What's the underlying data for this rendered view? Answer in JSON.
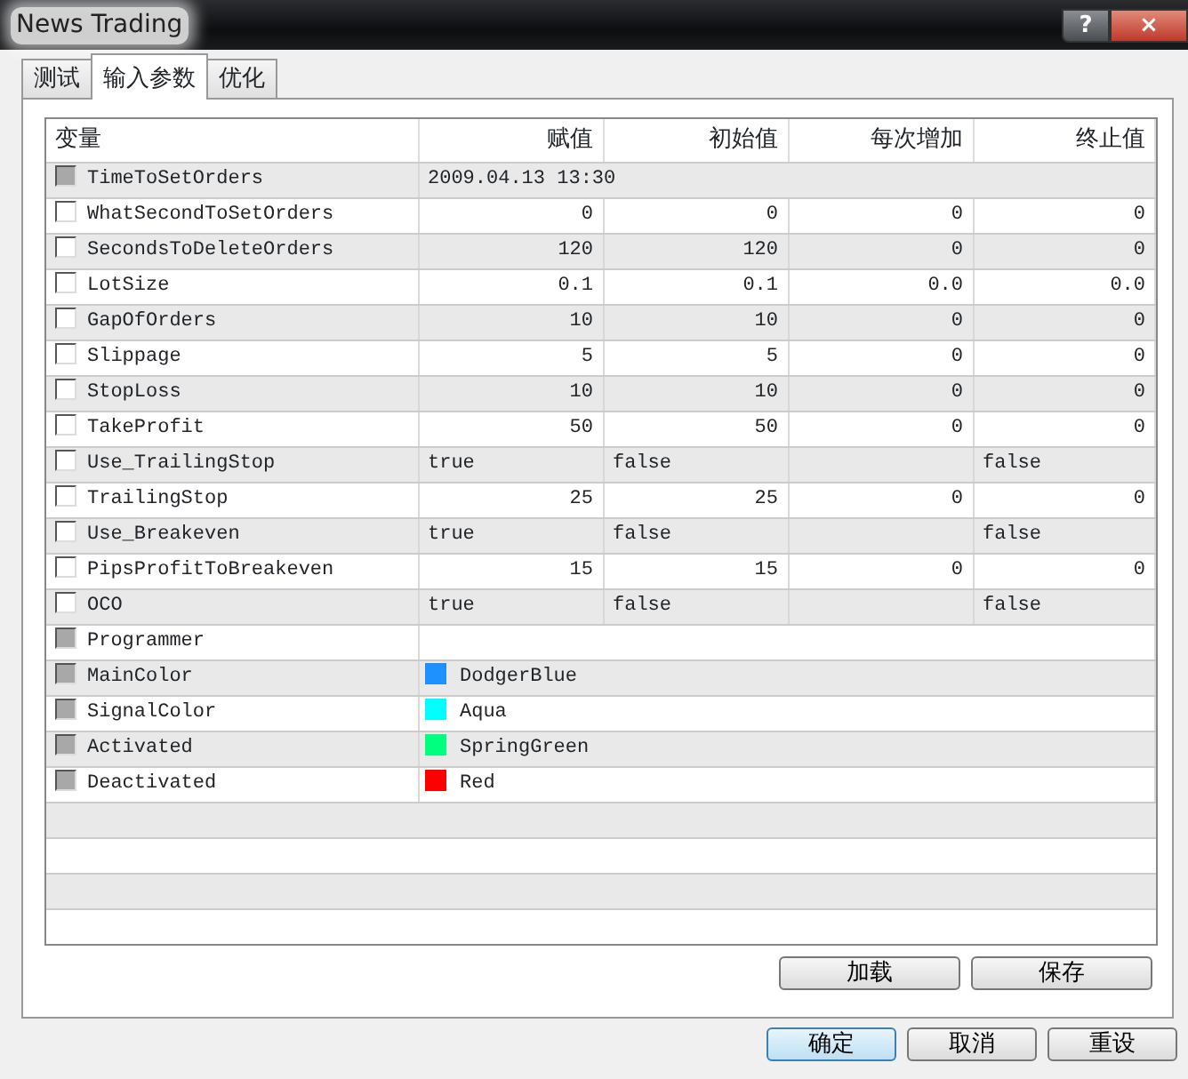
{
  "window": {
    "title": "News Trading",
    "controls": [
      "?",
      "×"
    ]
  },
  "tabs": [
    {
      "label": "测试",
      "selected": false
    },
    {
      "label": "输入参数",
      "selected": true
    },
    {
      "label": "优化",
      "selected": false
    }
  ],
  "table": {
    "columns": [
      "变量",
      "赋值",
      "初始值",
      "每次增加",
      "终止值"
    ],
    "rows": [
      {
        "kind": "span",
        "name": "TimeToSetOrders",
        "disabled": true,
        "checked": false,
        "value": "2009.04.13 13:30"
      },
      {
        "kind": "number",
        "name": "WhatSecondToSetOrders",
        "disabled": false,
        "checked": false,
        "value": "0",
        "start": "0",
        "step": "0",
        "stop": "0"
      },
      {
        "kind": "number",
        "name": "SecondsToDeleteOrders",
        "disabled": false,
        "checked": false,
        "value": "120",
        "start": "120",
        "step": "0",
        "stop": "0"
      },
      {
        "kind": "number",
        "name": "LotSize",
        "disabled": false,
        "checked": false,
        "value": "0.1",
        "start": "0.1",
        "step": "0.0",
        "stop": "0.0"
      },
      {
        "kind": "number",
        "name": "GapOfOrders",
        "disabled": false,
        "checked": false,
        "value": "10",
        "start": "10",
        "step": "0",
        "stop": "0"
      },
      {
        "kind": "number",
        "name": "Slippage",
        "disabled": false,
        "checked": false,
        "value": "5",
        "start": "5",
        "step": "0",
        "stop": "0"
      },
      {
        "kind": "number",
        "name": "StopLoss",
        "disabled": false,
        "checked": false,
        "value": "10",
        "start": "10",
        "step": "0",
        "stop": "0"
      },
      {
        "kind": "number",
        "name": "TakeProfit",
        "disabled": false,
        "checked": false,
        "value": "50",
        "start": "50",
        "step": "0",
        "stop": "0"
      },
      {
        "kind": "bool",
        "name": "Use_TrailingStop",
        "disabled": false,
        "checked": false,
        "value": "true",
        "start": "false",
        "stop": "false"
      },
      {
        "kind": "number",
        "name": "TrailingStop",
        "disabled": false,
        "checked": false,
        "value": "25",
        "start": "25",
        "step": "0",
        "stop": "0"
      },
      {
        "kind": "bool",
        "name": "Use_Breakeven",
        "disabled": false,
        "checked": false,
        "value": "true",
        "start": "false",
        "stop": "false"
      },
      {
        "kind": "number",
        "name": "PipsProfitToBreakeven",
        "disabled": false,
        "checked": false,
        "value": "15",
        "start": "15",
        "step": "0",
        "stop": "0"
      },
      {
        "kind": "bool",
        "name": "OCO",
        "disabled": false,
        "checked": false,
        "value": "true",
        "start": "false",
        "stop": "false"
      },
      {
        "kind": "span",
        "name": "Programmer",
        "disabled": true,
        "checked": false
      },
      {
        "kind": "color",
        "name": "MainColor",
        "disabled": true,
        "checked": false,
        "value": "DodgerBlue",
        "color": "#1e90ff"
      },
      {
        "kind": "color",
        "name": "SignalColor",
        "disabled": true,
        "checked": false,
        "value": "Aqua",
        "color": "#00ffff"
      },
      {
        "kind": "color",
        "name": "Activated",
        "disabled": true,
        "checked": false,
        "value": "SpringGreen",
        "color": "#00ff7f"
      },
      {
        "kind": "color",
        "name": "Deactivated",
        "disabled": true,
        "checked": false,
        "value": "Red",
        "color": "#ff0000"
      }
    ]
  },
  "panel_buttons": [
    "加载",
    "保存"
  ],
  "dialog_buttons": [
    {
      "label": "确定",
      "default": true
    },
    {
      "label": "取消",
      "default": false
    },
    {
      "label": "重设",
      "default": false
    }
  ]
}
